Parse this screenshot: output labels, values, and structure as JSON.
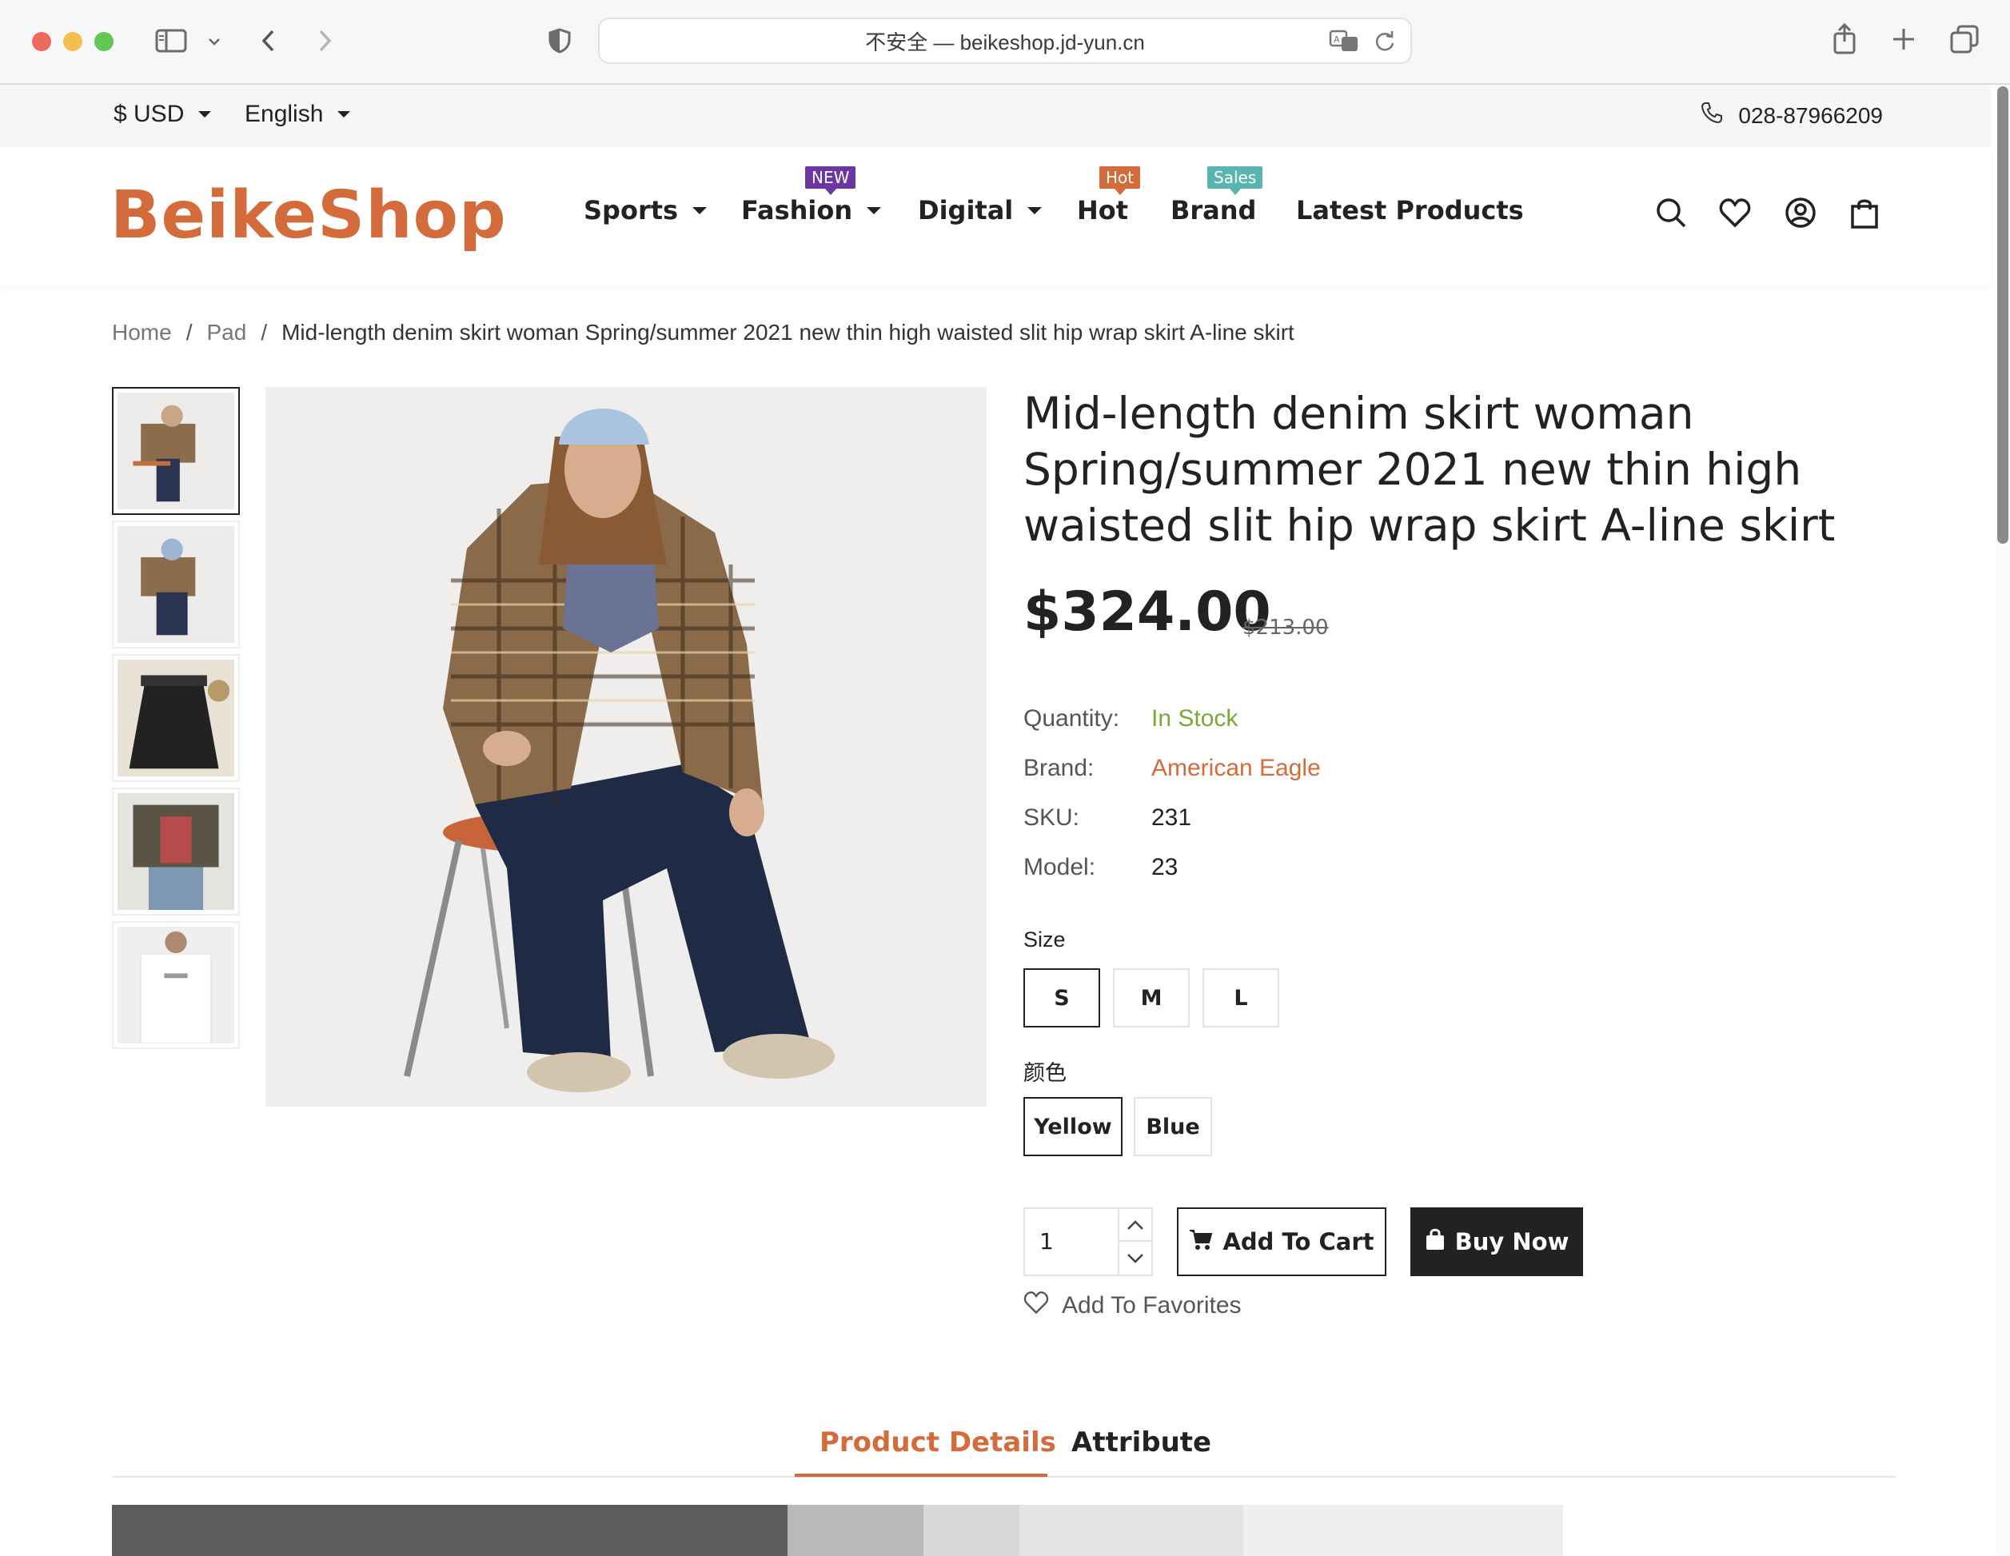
{
  "browser": {
    "url": "不安全 — beikeshop.jd-yun.cn"
  },
  "topbar": {
    "currency": "$ USD",
    "language": "English",
    "phone": "028-87966209"
  },
  "header": {
    "logo": "BeikeShop",
    "nav": [
      {
        "label": "Sports",
        "badge": ""
      },
      {
        "label": "Fashion",
        "badge": "NEW"
      },
      {
        "label": "Digital",
        "badge": ""
      },
      {
        "label": "Hot",
        "badge": "Hot"
      },
      {
        "label": "Brand",
        "badge": "Sales"
      },
      {
        "label": "Latest Products",
        "badge": ""
      }
    ]
  },
  "breadcrumb": {
    "home": "Home",
    "category": "Pad",
    "current": "Mid-length denim skirt woman Spring/summer 2021 new thin high waisted slit hip wrap skirt A-line skirt"
  },
  "product": {
    "title": "Mid-length denim skirt woman Spring/summer 2021 new thin high waisted slit hip wrap skirt A-line skirt",
    "price": "$324.00",
    "old_price": "$213.00",
    "attributes": [
      {
        "key": "Quantity:",
        "value": "In Stock"
      },
      {
        "key": "Brand:",
        "value": "American Eagle"
      },
      {
        "key": "SKU:",
        "value": "231"
      },
      {
        "key": "Model:",
        "value": "23"
      }
    ],
    "size_label": "Size",
    "sizes": [
      "S",
      "M",
      "L"
    ],
    "color_label": "颜色",
    "colors": [
      "Yellow",
      "Blue"
    ],
    "quantity": "1",
    "add_to_cart": "Add To Cart",
    "buy_now": "Buy Now",
    "add_to_favorites": "Add To Favorites",
    "colors_hex": {
      "accent": "#d46b3a",
      "in_stock": "#7aa936",
      "brand": "#d46b3a"
    }
  },
  "tabs": {
    "details": "Product Details",
    "attribute": "Attribute"
  }
}
